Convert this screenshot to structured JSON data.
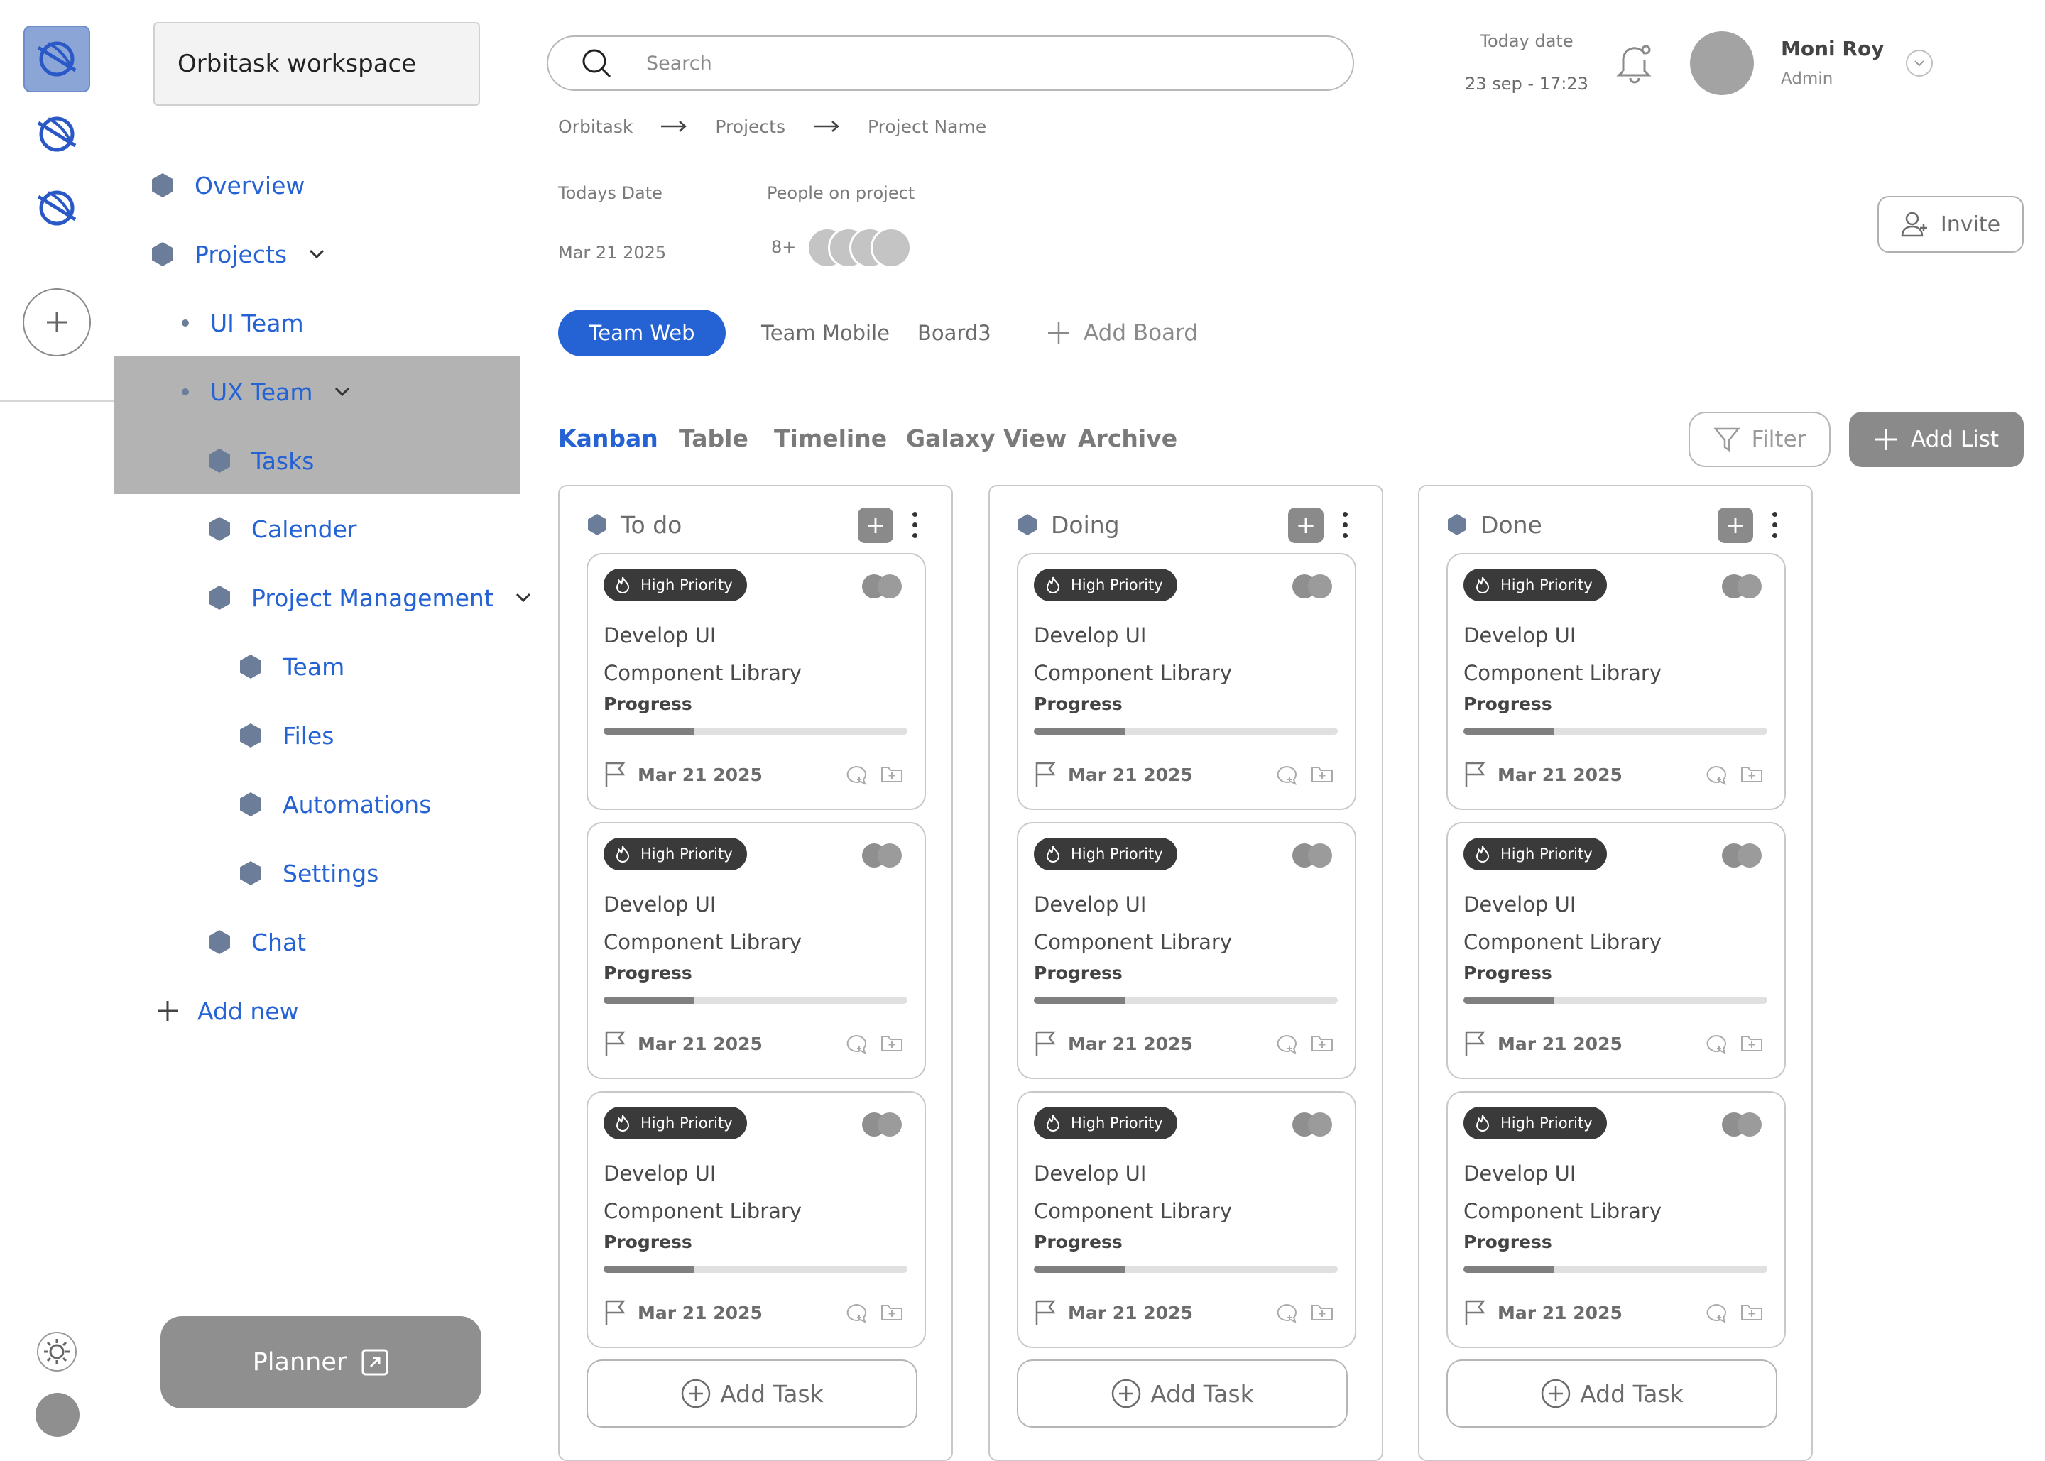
{
  "workspace": {
    "name": "Orbitask workspace"
  },
  "sidebar": {
    "items": [
      {
        "label": "Overview"
      },
      {
        "label": "Projects"
      },
      {
        "label": "UI Team"
      },
      {
        "label": "UX Team"
      },
      {
        "label": "Tasks"
      },
      {
        "label": "Calender"
      },
      {
        "label": "Project Management"
      },
      {
        "label": "Team"
      },
      {
        "label": "Files"
      },
      {
        "label": "Automations"
      },
      {
        "label": "Settings"
      },
      {
        "label": "Chat"
      }
    ],
    "add_new": "Add new",
    "planner": "Planner",
    "active_item": "Tasks"
  },
  "header": {
    "search_placeholder": "Search",
    "today_label": "Today date",
    "today_value": "23 sep - 17:23",
    "user_name": "Moni Roy",
    "user_role": "Admin"
  },
  "breadcrumb": [
    "Orbitask",
    "Projects",
    "Project Name"
  ],
  "project": {
    "date_label": "Todays Date",
    "date_value": "Mar 21 2025",
    "people_label": "People on project",
    "people_count": "8+",
    "invite": "Invite"
  },
  "boards": {
    "items": [
      "Team Web",
      "Team Mobile",
      "Board3"
    ],
    "active": "Team Web",
    "add": "Add Board"
  },
  "views": {
    "tabs": [
      "Kanban",
      "Table",
      "Timeline",
      "Galaxy View",
      "Archive"
    ],
    "active": "Kanban",
    "filter": "Filter",
    "add_list": "Add List"
  },
  "columns": [
    {
      "title": "To do"
    },
    {
      "title": "Doing"
    },
    {
      "title": "Done"
    }
  ],
  "card": {
    "badge": "High Priority",
    "title": "Develop UI\nComponent Library",
    "progress_label": "Progress",
    "progress": 0.3,
    "date": "Mar 21 2025"
  },
  "add_task": "Add Task",
  "colors": {
    "accent": "#2563d4",
    "active_nav_bg": "#b3b3b3",
    "badge_bg": "#3a3a3a",
    "button_gray": "#8a8a8a"
  },
  "icons": [
    "search-icon",
    "bell-icon",
    "chevron-down-icon",
    "user-plus-icon",
    "filter-icon",
    "plus-icon",
    "flame-icon",
    "flag-icon",
    "comment-icon",
    "folder-icon",
    "gear-icon",
    "external-link-icon",
    "logo-icon",
    "arrow-right-icon"
  ]
}
